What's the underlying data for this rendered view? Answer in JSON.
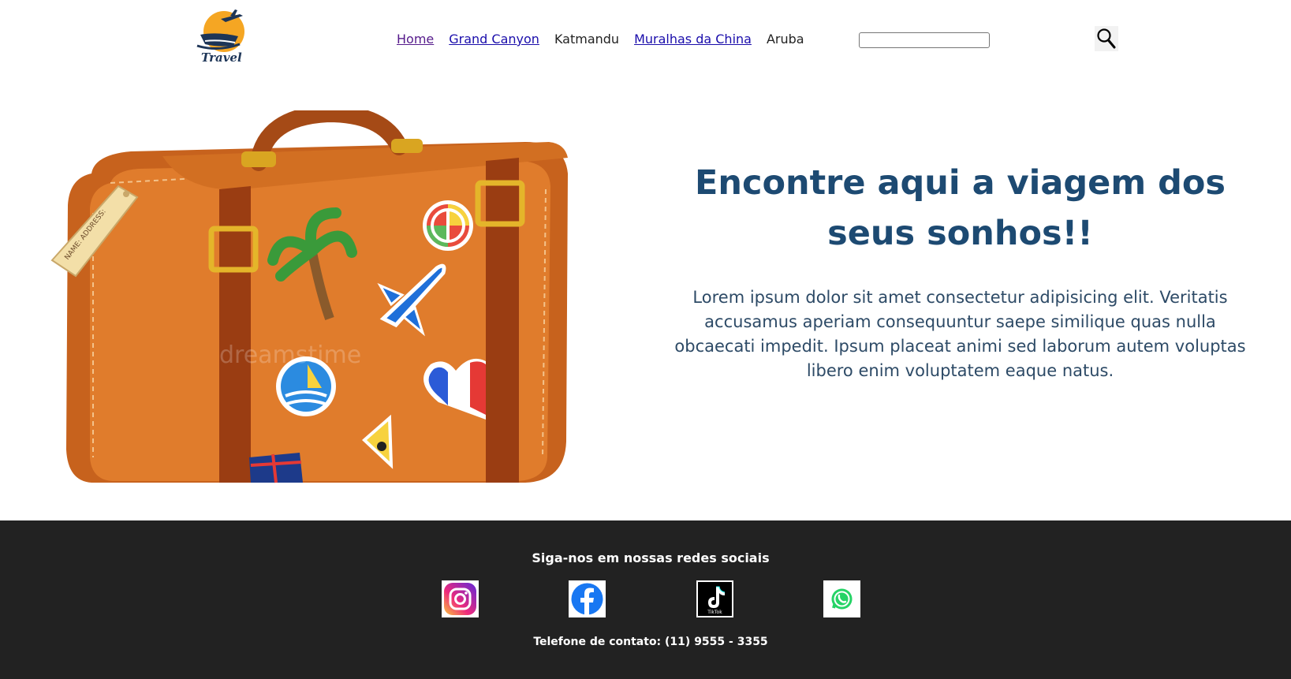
{
  "header": {
    "logo_text": "Travel",
    "nav": [
      {
        "label": "Home"
      },
      {
        "label": "Grand Canyon"
      },
      {
        "label": "Katmandu"
      },
      {
        "label": "Muralhas da China"
      },
      {
        "label": "Aruba"
      }
    ],
    "search": {
      "value": "",
      "placeholder": ""
    },
    "search_icon": "magnifier-icon"
  },
  "hero": {
    "image": "suitcase-with-stickers",
    "tag_text": "NAME: ADDRESS:",
    "watermark": "dreamstime",
    "title": "Encontre aqui a viagem dos seus sonhos!!",
    "description": "Lorem ipsum dolor sit amet consectetur adipisicing elit. Veritatis accusamus aperiam consequuntur saepe similique quas nulla obcaecati impedit. Ipsum placeat animi sed laborum autem voluptas libero enim voluptatem eaque natus."
  },
  "footer": {
    "title": "Siga-nos em nossas redes sociais",
    "social": [
      {
        "name": "instagram-icon"
      },
      {
        "name": "facebook-icon"
      },
      {
        "name": "tiktok-icon",
        "label": "TikTok"
      },
      {
        "name": "whatsapp-icon"
      }
    ],
    "phone": "Telefone de contato: (11) 9555 - 3355"
  },
  "colors": {
    "title": "#1d4a72",
    "footer_bg": "#222222",
    "link": "#1a0dab",
    "visited": "#551a8b"
  }
}
